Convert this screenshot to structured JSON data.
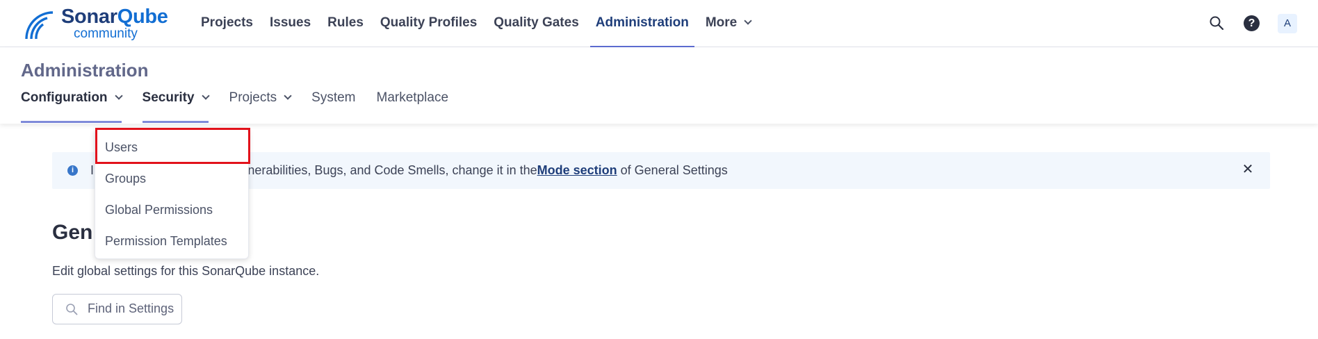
{
  "brand": {
    "name_part1": "Sonar",
    "name_part2": "Qube",
    "edition": "community"
  },
  "topnav": {
    "items": [
      {
        "label": "Projects"
      },
      {
        "label": "Issues"
      },
      {
        "label": "Rules"
      },
      {
        "label": "Quality Profiles"
      },
      {
        "label": "Quality Gates"
      },
      {
        "label": "Administration",
        "active": true
      },
      {
        "label": "More"
      }
    ],
    "help_label": "?",
    "avatar_initial": "A"
  },
  "admin": {
    "title": "Administration",
    "tabs": [
      {
        "label": "Configuration"
      },
      {
        "label": "Security"
      },
      {
        "label": "Projects"
      },
      {
        "label": "System"
      },
      {
        "label": "Marketplace"
      }
    ]
  },
  "security_menu": {
    "items": [
      {
        "label": "Users",
        "highlighted": true
      },
      {
        "label": "Groups"
      },
      {
        "label": "Global Permissions"
      },
      {
        "label": "Permission Templates"
      }
    ],
    "highlight_color": "#e2121b"
  },
  "banner": {
    "icon_label": "i",
    "text_start": "I",
    "text_visible": "g with Vulnerabilities, Bugs, and Code Smells, change it in the ",
    "link": "Mode section",
    "text_end": " of General Settings"
  },
  "general": {
    "heading_visible": "Gen",
    "description": "Edit global settings for this SonarQube instance.",
    "search_placeholder": "Find in Settings"
  },
  "colors": {
    "accent": "#5d6cd0",
    "brand_dark": "#1f3e7a",
    "brand_blue": "#126ed3"
  }
}
